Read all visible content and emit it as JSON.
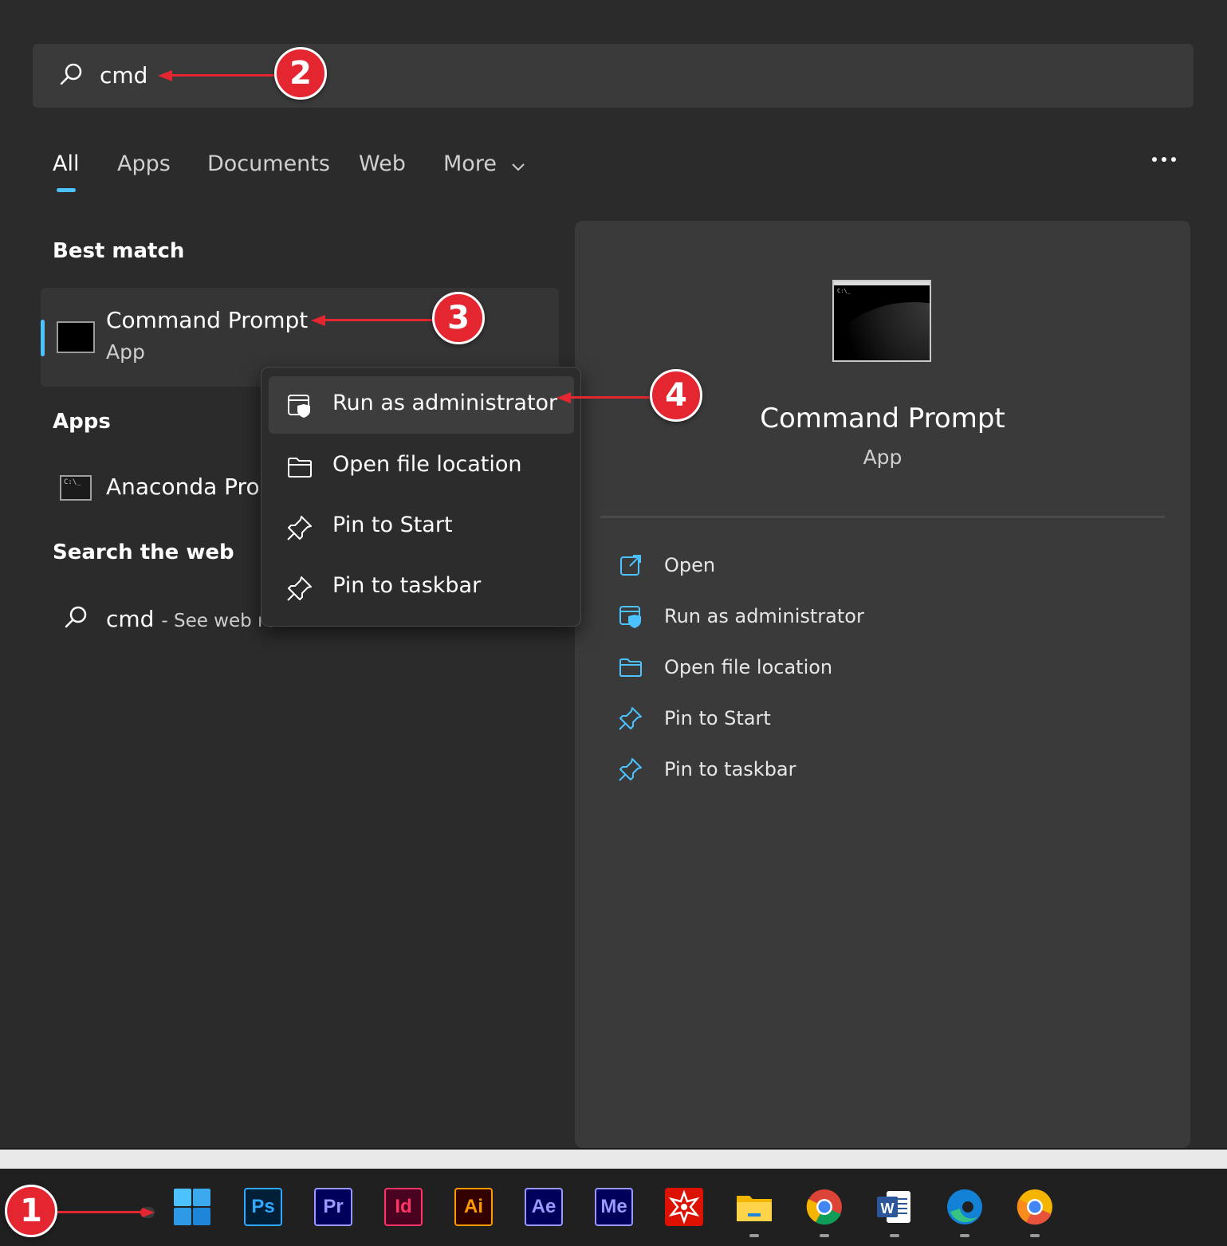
{
  "search": {
    "query": "cmd"
  },
  "tabs": [
    {
      "label": "All"
    },
    {
      "label": "Apps"
    },
    {
      "label": "Documents"
    },
    {
      "label": "Web"
    },
    {
      "label": "More"
    }
  ],
  "sections": {
    "best_match": "Best match",
    "apps": "Apps",
    "search_web": "Search the web"
  },
  "best_match": {
    "title": "Command Prompt",
    "subtitle": "App"
  },
  "apps_list": [
    {
      "label": "Anaconda Prom",
      "icon_text": "C:\\_"
    }
  ],
  "web_result": {
    "query": "cmd",
    "suffix": "- See web re"
  },
  "context_menu": [
    {
      "label": "Run as administrator",
      "icon": "shield-window-icon"
    },
    {
      "label": "Open file location",
      "icon": "folder-icon"
    },
    {
      "label": "Pin to Start",
      "icon": "pin-icon"
    },
    {
      "label": "Pin to taskbar",
      "icon": "pin-icon"
    }
  ],
  "detail": {
    "title": "Command Prompt",
    "subtitle": "App",
    "thumb_text": "C:\\_",
    "actions": [
      {
        "label": "Open",
        "icon": "open-external-icon"
      },
      {
        "label": "Run as administrator",
        "icon": "shield-window-icon"
      },
      {
        "label": "Open file location",
        "icon": "folder-icon"
      },
      {
        "label": "Pin to Start",
        "icon": "pin-icon"
      },
      {
        "label": "Pin to taskbar",
        "icon": "pin-icon"
      }
    ]
  },
  "callouts": [
    "1",
    "2",
    "3",
    "4"
  ],
  "taskbar": [
    {
      "name": "start",
      "label": ""
    },
    {
      "name": "photoshop",
      "label": "Ps",
      "bg": "#001e36",
      "fg": "#31a8ff"
    },
    {
      "name": "premiere",
      "label": "Pr",
      "bg": "#00005b",
      "fg": "#9999ff"
    },
    {
      "name": "indesign",
      "label": "Id",
      "bg": "#49021f",
      "fg": "#ff3366"
    },
    {
      "name": "illustrator",
      "label": "Ai",
      "bg": "#330000",
      "fg": "#ff9a00"
    },
    {
      "name": "after-effects",
      "label": "Ae",
      "bg": "#00005b",
      "fg": "#9999ff"
    },
    {
      "name": "media-encoder",
      "label": "Me",
      "bg": "#00005b",
      "fg": "#9999ff"
    },
    {
      "name": "wolfram",
      "label": "",
      "bg": "#dd1100"
    },
    {
      "name": "file-explorer",
      "label": ""
    },
    {
      "name": "chrome",
      "label": ""
    },
    {
      "name": "word",
      "label": "W"
    },
    {
      "name": "edge",
      "label": ""
    },
    {
      "name": "chrome-canary",
      "label": ""
    }
  ],
  "colors": {
    "accent": "#4cc2ff",
    "callout": "#e32630",
    "panel": "#2b2b2b"
  }
}
